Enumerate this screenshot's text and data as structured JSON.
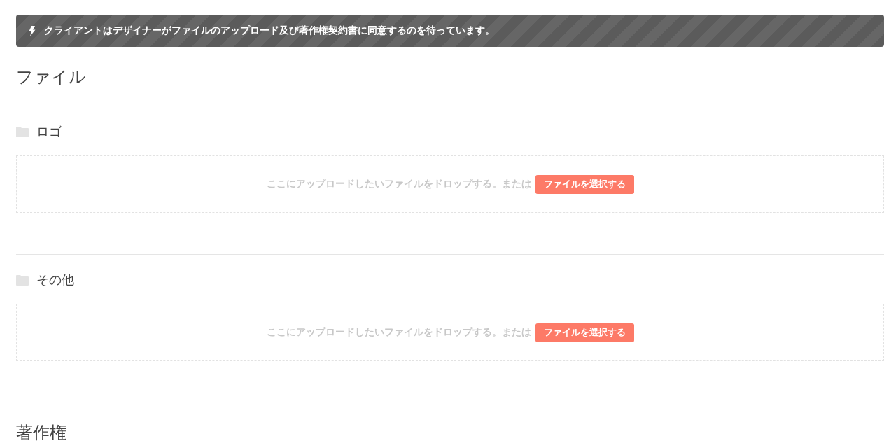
{
  "notice": {
    "text": "クライアントはデザイナーがファイルのアップロード及び著作権契約書に同意するのを待っています。"
  },
  "files_section": {
    "heading": "ファイル",
    "folders": [
      {
        "name": "ロゴ",
        "drop_text": "ここにアップロードしたいファイルをドロップする。または",
        "button": "ファイルを選択する"
      },
      {
        "name": "その他",
        "drop_text": "ここにアップロードしたいファイルをドロップする。または",
        "button": "ファイルを選択する"
      }
    ]
  },
  "copyright_section": {
    "heading": "著作権"
  }
}
